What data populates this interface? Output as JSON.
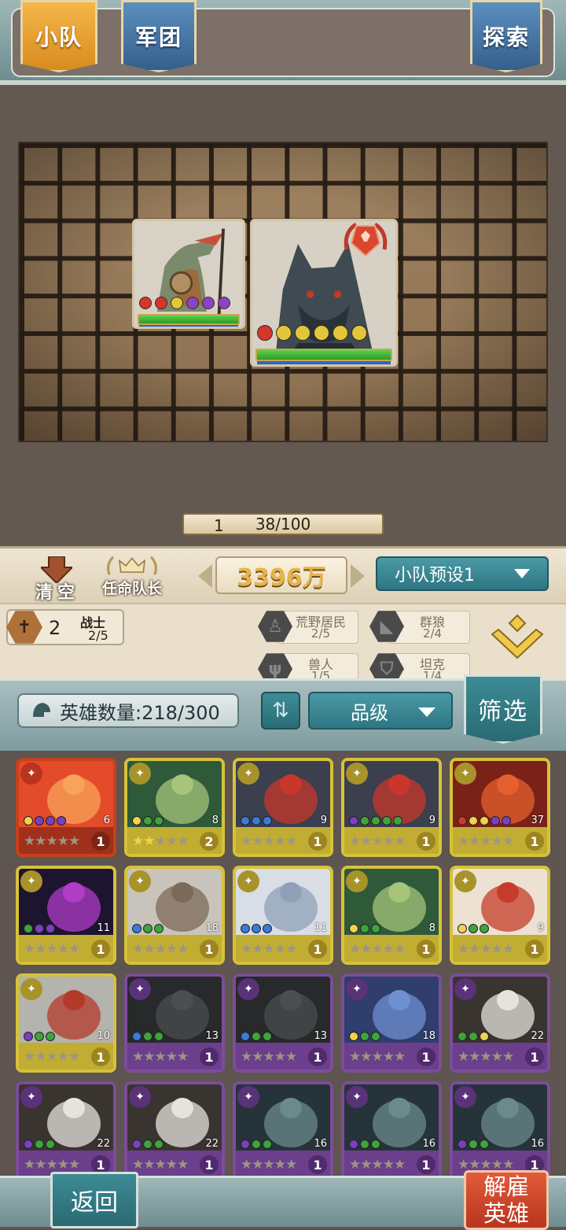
{
  "tabs": {
    "squad": "小队",
    "legion": "军团",
    "explore": "探索"
  },
  "board": {
    "level": "1",
    "xp": "38/100"
  },
  "info": {
    "clear": "清空",
    "appoint_captain": "任命队长",
    "power": "3396万",
    "preset": "小队预设1"
  },
  "synergy": {
    "active": {
      "count": "2",
      "name": "战士",
      "progress": "2/5"
    },
    "traits": [
      {
        "name": "荒野居民",
        "progress": "2/5"
      },
      {
        "name": "群狼",
        "progress": "2/4"
      },
      {
        "name": "兽人",
        "progress": "1/5"
      },
      {
        "name": "坦克",
        "progress": "1/4"
      }
    ]
  },
  "heroes_toolbar": {
    "count_label": "英雄数量:218/300",
    "sort_label": "品级",
    "filter": "筛选"
  },
  "heroes": [
    {
      "rarity": "red",
      "stars": 0,
      "level": "1",
      "cost": "6",
      "dots": [
        "#f2d24b",
        "#7b3fc2",
        "#7b3fc2",
        "#7b3fc2"
      ],
      "art": "fire-dragon"
    },
    {
      "rarity": "gold",
      "stars": 2,
      "level": "2",
      "cost": "8",
      "dots": [
        "#f2d24b",
        "#3fa43a",
        "#3fa43a"
      ],
      "art": "hooded-reaper"
    },
    {
      "rarity": "gold",
      "stars": 0,
      "level": "1",
      "cost": "9",
      "dots": [
        "#3b7ad6",
        "#3b7ad6",
        "#3b7ad6"
      ],
      "art": "red-demon-warrior"
    },
    {
      "rarity": "gold",
      "stars": 0,
      "level": "1",
      "cost": "9",
      "dots": [
        "#7b3fc2",
        "#3fa43a",
        "#3fa43a",
        "#3fa43a",
        "#3fa43a"
      ],
      "art": "red-demon-warrior"
    },
    {
      "rarity": "gold",
      "stars": 0,
      "level": "1",
      "cost": "37",
      "dots": [
        "#d6352a",
        "#f2d24b",
        "#f2d24b",
        "#7b3fc2",
        "#7b3fc2"
      ],
      "art": "fire-beast"
    },
    {
      "rarity": "gold",
      "stars": 0,
      "level": "1",
      "cost": "11",
      "dots": [
        "#3fa43a",
        "#7b3fc2",
        "#7b3fc2"
      ],
      "art": "shadow-spirit"
    },
    {
      "rarity": "gold",
      "stars": 0,
      "level": "1",
      "cost": "18",
      "dots": [
        "#3b7ad6",
        "#3fa43a",
        "#3fa43a"
      ],
      "art": "white-knight"
    },
    {
      "rarity": "gold",
      "stars": 0,
      "level": "1",
      "cost": "11",
      "dots": [
        "#3b7ad6",
        "#3b7ad6",
        "#3b7ad6"
      ],
      "art": "light-angel"
    },
    {
      "rarity": "gold",
      "stars": 0,
      "level": "1",
      "cost": "8",
      "dots": [
        "#f2d24b",
        "#3fa43a",
        "#3fa43a"
      ],
      "art": "hooded-reaper"
    },
    {
      "rarity": "gold",
      "stars": 0,
      "level": "1",
      "cost": "9",
      "dots": [
        "#f2d24b",
        "#3fa43a",
        "#3fa43a"
      ],
      "art": "bunny-girl"
    },
    {
      "rarity": "gold",
      "stars": 0,
      "level": "1",
      "cost": "10",
      "dots": [
        "#7b3fc2",
        "#3fa43a",
        "#3fa43a"
      ],
      "art": "horned-knight"
    },
    {
      "rarity": "purple",
      "stars": 0,
      "level": "1",
      "cost": "13",
      "dots": [
        "#3b7ad6",
        "#3fa43a",
        "#3fa43a"
      ],
      "art": "dark-necromancer"
    },
    {
      "rarity": "purple",
      "stars": 0,
      "level": "1",
      "cost": "13",
      "dots": [
        "#3b7ad6",
        "#3fa43a",
        "#3fa43a"
      ],
      "art": "dark-necromancer"
    },
    {
      "rarity": "purple",
      "stars": 0,
      "level": "1",
      "cost": "18",
      "dots": [
        "#f2d24b",
        "#3fa43a",
        "#3fa43a"
      ],
      "art": "blue-werewolf"
    },
    {
      "rarity": "purple",
      "stars": 0,
      "level": "1",
      "cost": "22",
      "dots": [
        "#3fa43a",
        "#3fa43a",
        "#f2d24b"
      ],
      "art": "white-yeti"
    },
    {
      "rarity": "purple",
      "stars": 0,
      "level": "1",
      "cost": "22",
      "dots": [
        "#7b3fc2",
        "#3fa43a",
        "#3fa43a"
      ],
      "art": "white-yeti"
    },
    {
      "rarity": "purple",
      "stars": 0,
      "level": "1",
      "cost": "22",
      "dots": [
        "#7b3fc2",
        "#3fa43a",
        "#3fa43a"
      ],
      "art": "white-yeti"
    },
    {
      "rarity": "purple",
      "stars": 0,
      "level": "1",
      "cost": "16",
      "dots": [
        "#7b3fc2",
        "#3fa43a",
        "#3fa43a"
      ],
      "art": "dark-rat-beast"
    },
    {
      "rarity": "purple",
      "stars": 0,
      "level": "1",
      "cost": "16",
      "dots": [
        "#7b3fc2",
        "#3fa43a",
        "#3fa43a"
      ],
      "art": "dark-rat-beast"
    },
    {
      "rarity": "purple",
      "stars": 0,
      "level": "1",
      "cost": "16",
      "dots": [
        "#7b3fc2",
        "#3fa43a",
        "#3fa43a"
      ],
      "art": "dark-rat-beast"
    }
  ],
  "footer": {
    "back": "返回",
    "dismiss": "解雇英雄"
  }
}
